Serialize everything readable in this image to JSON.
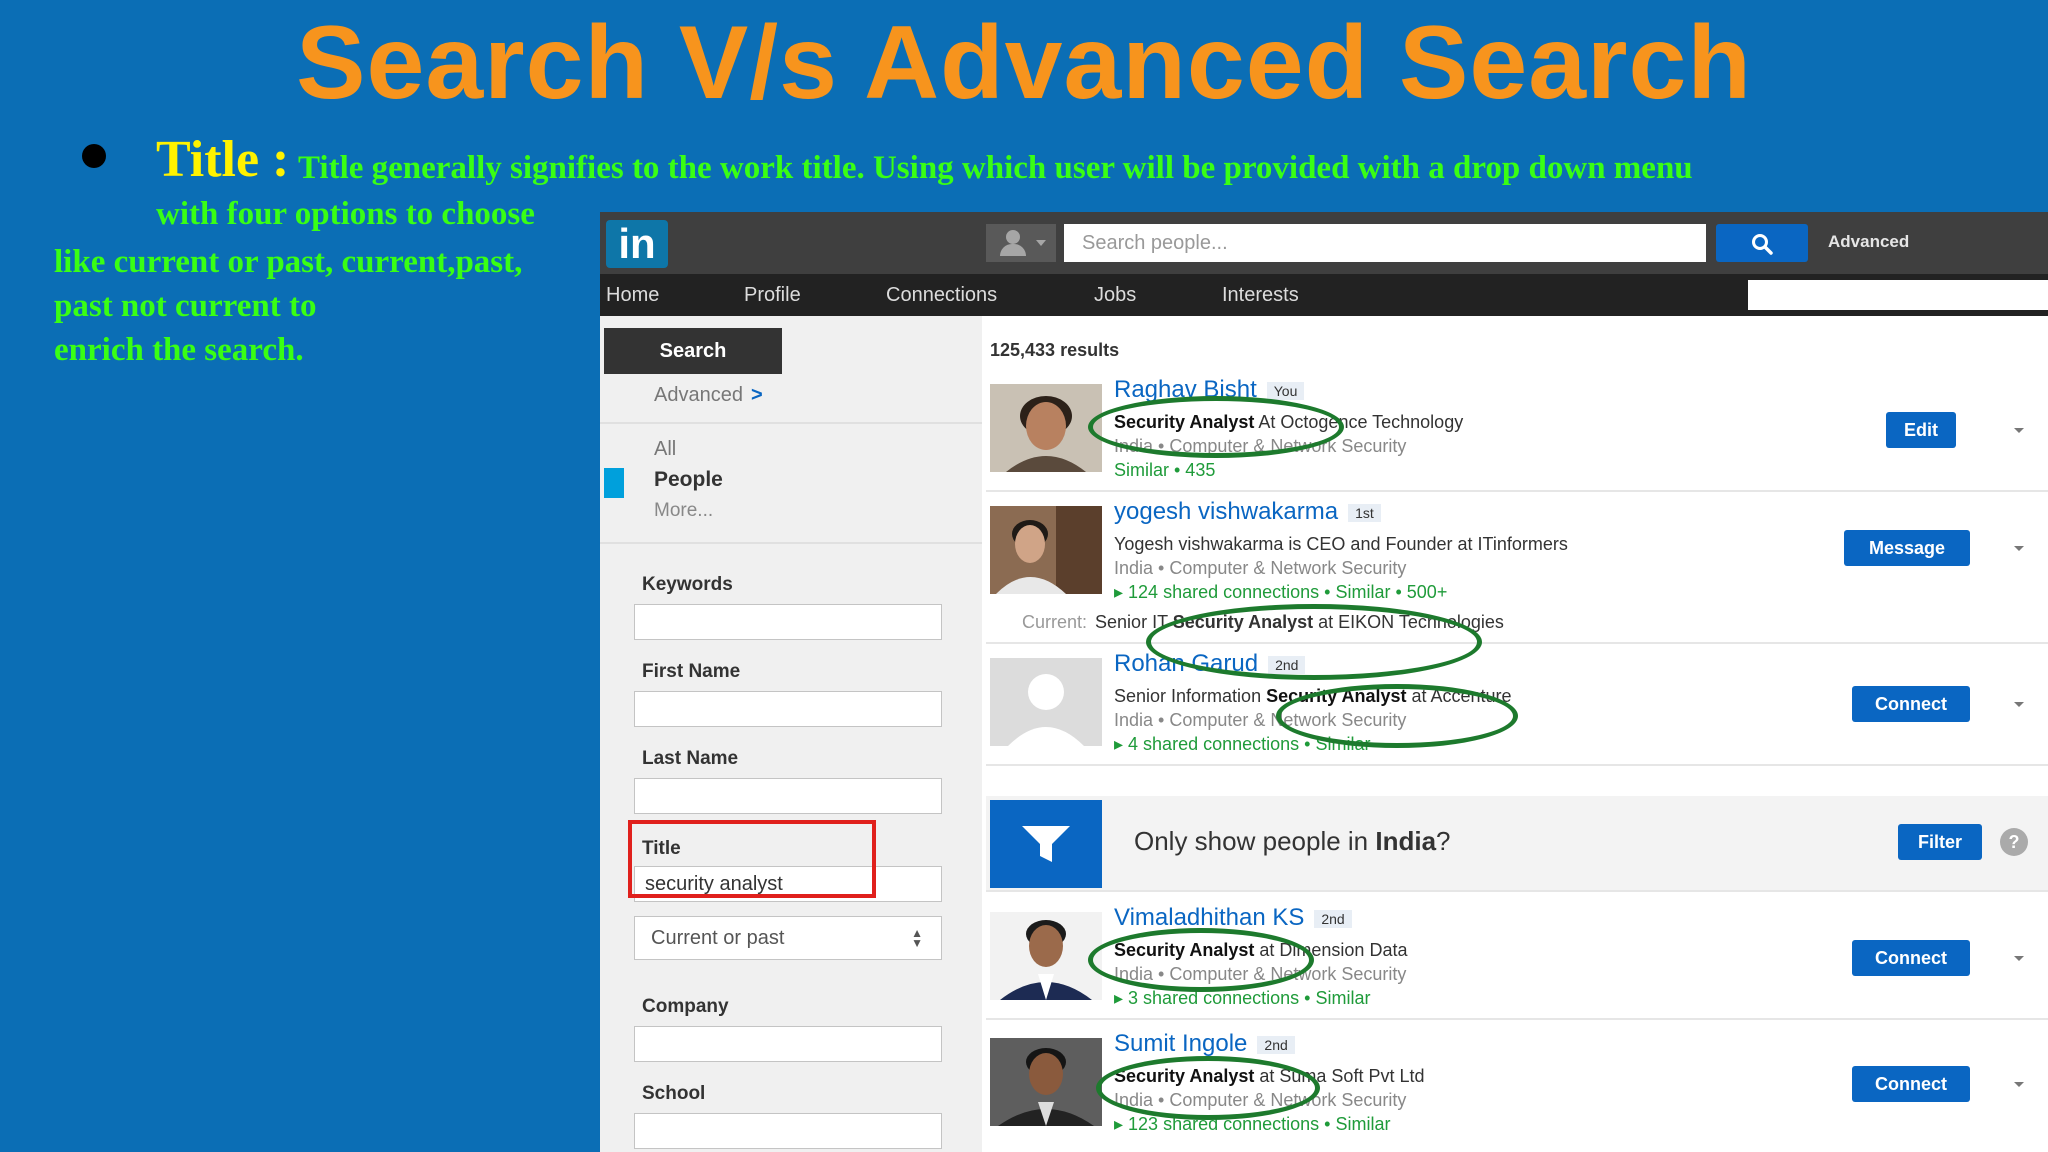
{
  "slide": {
    "title": "Search V/s Advanced Search",
    "bullet_term": "Title :",
    "desc_line1": "Title generally signifies to the work title. Using which user will be provided with a drop down menu",
    "desc_line2": "with four options to choose",
    "desc_line3": "like current or past, current,past,",
    "desc_line4": "past not current to",
    "desc_line5": "enrich the search."
  },
  "app": {
    "logo": "in",
    "search_placeholder": "Search people...",
    "advanced_label": "Advanced",
    "nav": [
      "Home",
      "Profile",
      "Connections",
      "Jobs",
      "Interests"
    ]
  },
  "sidebar": {
    "search_tab": "Search",
    "advanced": "Advanced",
    "advanced_chevron": ">",
    "types": [
      "All",
      "People",
      "More..."
    ],
    "fields": {
      "keywords_label": "Keywords",
      "first_name_label": "First Name",
      "last_name_label": "Last Name",
      "title_label": "Title",
      "title_value": "security analyst",
      "title_scope": "Current or past",
      "company_label": "Company",
      "school_label": "School"
    }
  },
  "results": {
    "count": "125,433 results",
    "items": [
      {
        "name": "Raghav Bisht",
        "degree": "You",
        "headline_bold": "Security Analyst",
        "headline_rest": " At Octogence Technology",
        "location": "India • Computer & Network Security",
        "connections": "Similar • 435",
        "action": "Edit"
      },
      {
        "name": "yogesh vishwakarma",
        "degree": "1st",
        "headline_rest": "Yogesh vishwakarma is CEO and Founder at ITinformers",
        "location": "India • Computer & Network Security",
        "connections": "▸ 124 shared connections • Similar • 500+",
        "current_label": "Current:",
        "current_pre": "Senior IT ",
        "current_bold": "Security Analyst",
        "current_post": " at EIKON Technologies",
        "action": "Message"
      },
      {
        "name": "Rohan Garud",
        "degree": "2nd",
        "headline_pre": "Senior Information ",
        "headline_bold": "Security Analyst",
        "headline_rest": " at Accenture",
        "location": "India • Computer & Network Security",
        "connections": "▸ 4 shared connections • Similar",
        "action": "Connect"
      },
      {
        "name": "Vimaladhithan KS",
        "degree": "2nd",
        "headline_bold": "Security Analyst",
        "headline_rest": " at Dimension Data",
        "location": "India • Computer & Network Security",
        "connections": "▸ 3 shared connections • Similar",
        "action": "Connect"
      },
      {
        "name": "Sumit Ingole",
        "degree": "2nd",
        "headline_bold": "Security Analyst",
        "headline_rest": " at Suma Soft Pvt Ltd",
        "location": "India • Computer & Network Security",
        "connections": "▸ 123 shared connections • Similar",
        "action": "Connect"
      }
    ],
    "filter": {
      "text_pre": "Only show people in ",
      "text_bold": "India",
      "text_post": "?",
      "button": "Filter",
      "help": "?"
    }
  }
}
